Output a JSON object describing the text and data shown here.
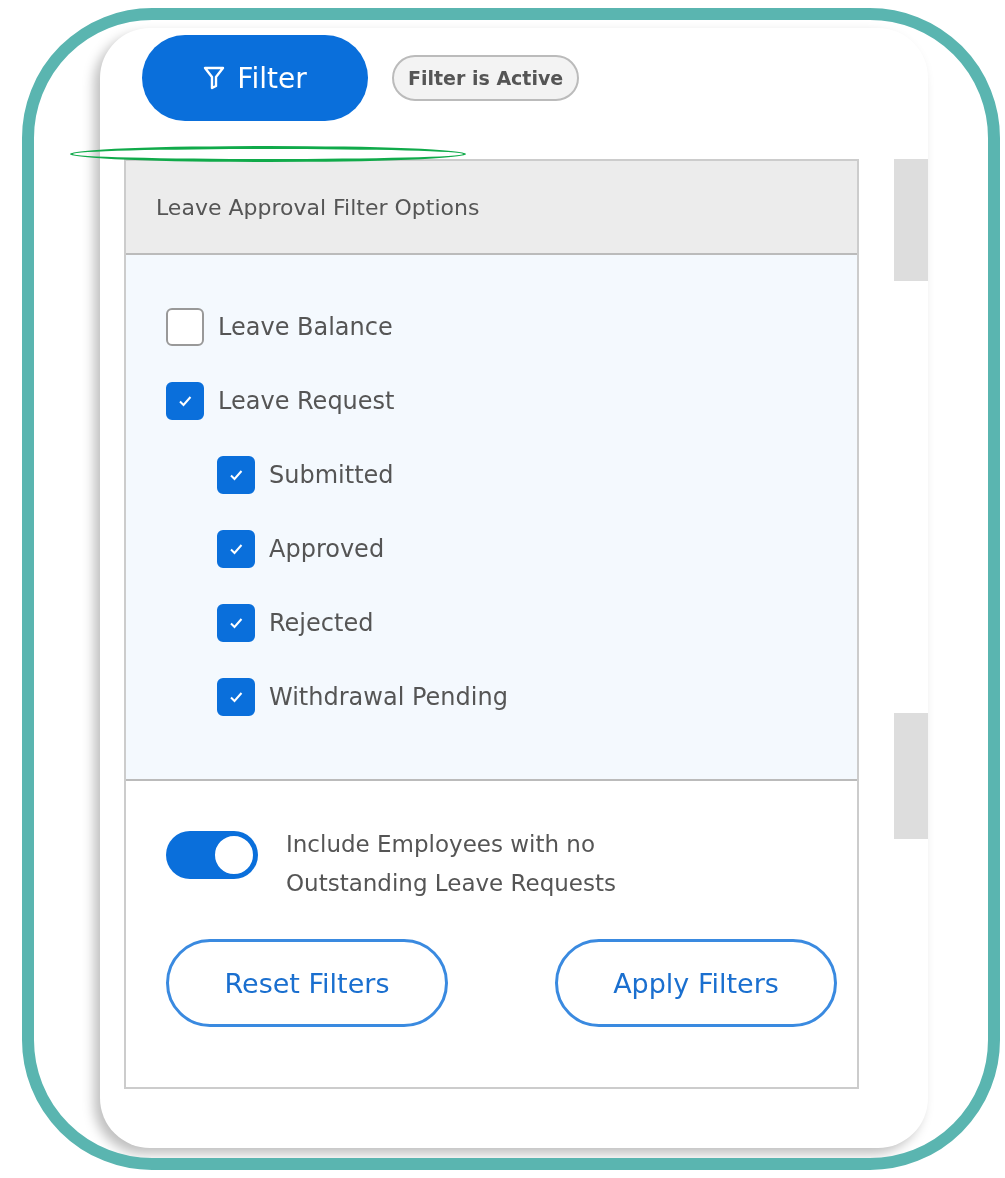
{
  "filter_button": {
    "label": "Filter"
  },
  "status_badge": {
    "label": "Filter is Active"
  },
  "panel": {
    "title": "Leave Approval Filter Options",
    "options": [
      {
        "label": "Leave Balance",
        "checked": false
      },
      {
        "label": "Leave Request",
        "checked": true,
        "children": [
          {
            "label": "Submitted",
            "checked": true
          },
          {
            "label": "Approved",
            "checked": true
          },
          {
            "label": "Rejected",
            "checked": true
          },
          {
            "label": "Withdrawal Pending",
            "checked": true
          }
        ]
      }
    ],
    "toggle": {
      "label": "Include Employees with no Outstanding Leave Requests",
      "on": true
    },
    "buttons": [
      "Reset Filters",
      "Apply Filters"
    ]
  }
}
